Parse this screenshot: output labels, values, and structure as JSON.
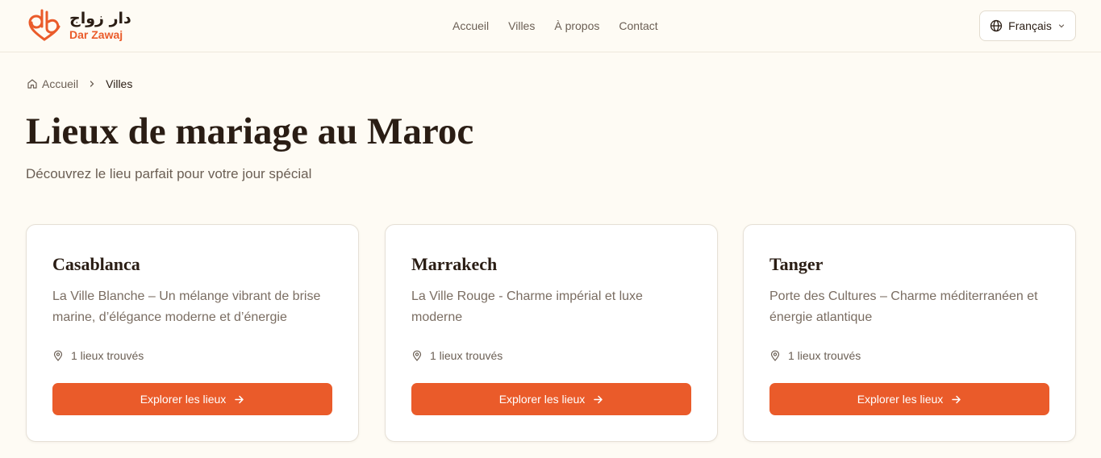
{
  "brand": {
    "name_ar": "دار زواج",
    "name_en": "Dar Zawaj",
    "accent_color": "#ea5b2a"
  },
  "nav": {
    "items": [
      {
        "label": "Accueil"
      },
      {
        "label": "Villes"
      },
      {
        "label": "À propos"
      },
      {
        "label": "Contact"
      }
    ]
  },
  "language": {
    "selected": "Français",
    "icon": "globe-icon"
  },
  "breadcrumb": {
    "home_label": "Accueil",
    "current_label": "Villes"
  },
  "page": {
    "title": "Lieux de mariage au Maroc",
    "subtitle": "Découvrez le lieu parfait pour votre jour spécial"
  },
  "cities": [
    {
      "name": "Casablanca",
      "description": "La Ville Blanche – Un mélange vibrant de brise marine, d’élégance moderne et d’énergie",
      "count_label": "1 lieux trouvés",
      "button_label": "Explorer les lieux"
    },
    {
      "name": "Marrakech",
      "description": "La Ville Rouge - Charme impérial et luxe moderne",
      "count_label": "1 lieux trouvés",
      "button_label": "Explorer les lieux"
    },
    {
      "name": "Tanger",
      "description": "Porte des Cultures – Charme méditerranéen et énergie atlantique",
      "count_label": "1 lieux trouvés",
      "button_label": "Explorer les lieux"
    }
  ]
}
